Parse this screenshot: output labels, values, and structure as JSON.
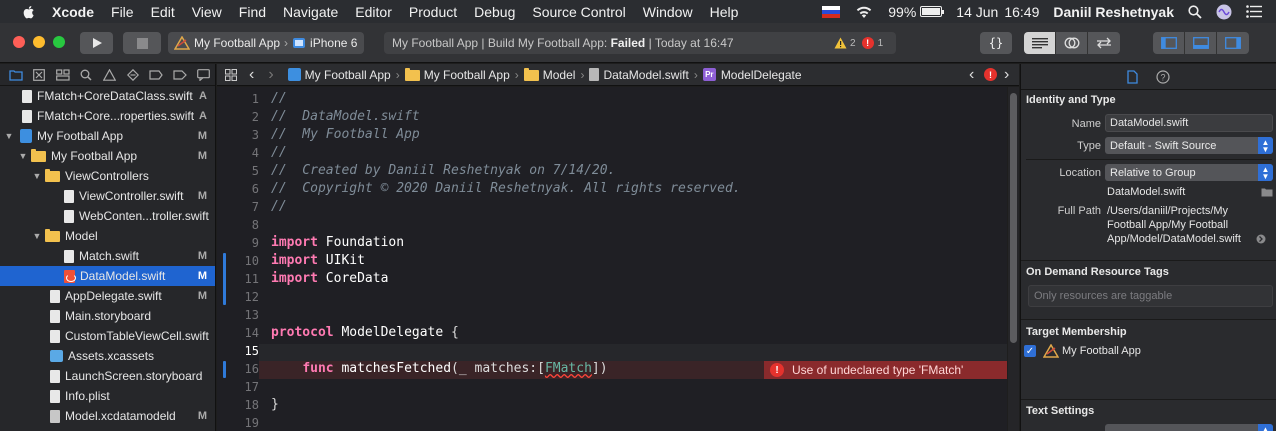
{
  "menubar": {
    "items": [
      "Xcode",
      "File",
      "Edit",
      "View",
      "Find",
      "Navigate",
      "Editor",
      "Product",
      "Debug",
      "Source Control",
      "Window",
      "Help"
    ],
    "battery": "99%",
    "date": "14 Jun",
    "time": "16:49",
    "user": "Daniil Reshetnyak"
  },
  "toolbar": {
    "scheme_target": "My Football App",
    "scheme_device": "iPhone 6",
    "activity_prefix": "My Football App | Build My Football App: ",
    "activity_status": "Failed",
    "activity_suffix": " | Today at 16:47",
    "warnings": "2",
    "errors": "1"
  },
  "navigator": {
    "items": [
      {
        "label": "FMatch+CoreDataClass.swift",
        "status": "A"
      },
      {
        "label": "FMatch+Core...roperties.swift",
        "status": "A"
      },
      {
        "label": "My Football App",
        "status": "M"
      },
      {
        "label": "My Football App",
        "status": "M"
      },
      {
        "label": "ViewControllers",
        "status": ""
      },
      {
        "label": "ViewController.swift",
        "status": "M"
      },
      {
        "label": "WebConten...troller.swift",
        "status": ""
      },
      {
        "label": "Model",
        "status": ""
      },
      {
        "label": "Match.swift",
        "status": "M"
      },
      {
        "label": "DataModel.swift",
        "status": "M"
      },
      {
        "label": "AppDelegate.swift",
        "status": "M"
      },
      {
        "label": "Main.storyboard",
        "status": ""
      },
      {
        "label": "CustomTableViewCell.swift",
        "status": ""
      },
      {
        "label": "Assets.xcassets",
        "status": ""
      },
      {
        "label": "LaunchScreen.storyboard",
        "status": ""
      },
      {
        "label": "Info.plist",
        "status": ""
      },
      {
        "label": "Model.xcdatamodeld",
        "status": "M"
      }
    ]
  },
  "jumpbar": {
    "crumbs": [
      "My Football App",
      "My Football App",
      "Model",
      "DataModel.swift",
      "ModelDelegate"
    ]
  },
  "editor": {
    "line_numbers": [
      "1",
      "2",
      "3",
      "4",
      "5",
      "6",
      "7",
      "8",
      "9",
      "10",
      "11",
      "12",
      "13",
      "14",
      "15",
      "16",
      "17",
      "18",
      "19"
    ],
    "comments": [
      "//",
      "//  DataModel.swift",
      "//  My Football App",
      "//",
      "//  Created by Daniil Reshetnyak on 7/14/20.",
      "//  Copyright © 2020 Daniil Reshetnyak. All rights reserved.",
      "//"
    ],
    "kw_import": "import",
    "kw_protocol": "protocol",
    "kw_func": "func",
    "mod_foundation": "Foundation",
    "mod_uikit": "UIKit",
    "mod_coredata": "CoreData",
    "protocol_name": "ModelDelegate",
    "brace_open": " {",
    "func_name": "matchesFetched",
    "func_params_a": "(_ matches:[",
    "func_type": "FMatch",
    "func_params_b": "])",
    "brace_close": "}",
    "error_message": "Use of undeclared type 'FMatch'"
  },
  "inspector": {
    "identity_title": "Identity and Type",
    "name_label": "Name",
    "name_value": "DataModel.swift",
    "type_label": "Type",
    "type_value": "Default - Swift Source",
    "location_label": "Location",
    "location_value": "Relative to Group",
    "location_file": "DataModel.swift",
    "fullpath_label": "Full Path",
    "fullpath_line1": "/Users/daniil/Projects/My",
    "fullpath_line2": "Football App/My Football",
    "fullpath_line3": "App/Model/DataModel.swift",
    "odr_title": "On Demand Resource Tags",
    "odr_placeholder": "Only resources are taggable",
    "target_title": "Target Membership",
    "target_name": "My Football App",
    "text_title": "Text Settings"
  }
}
